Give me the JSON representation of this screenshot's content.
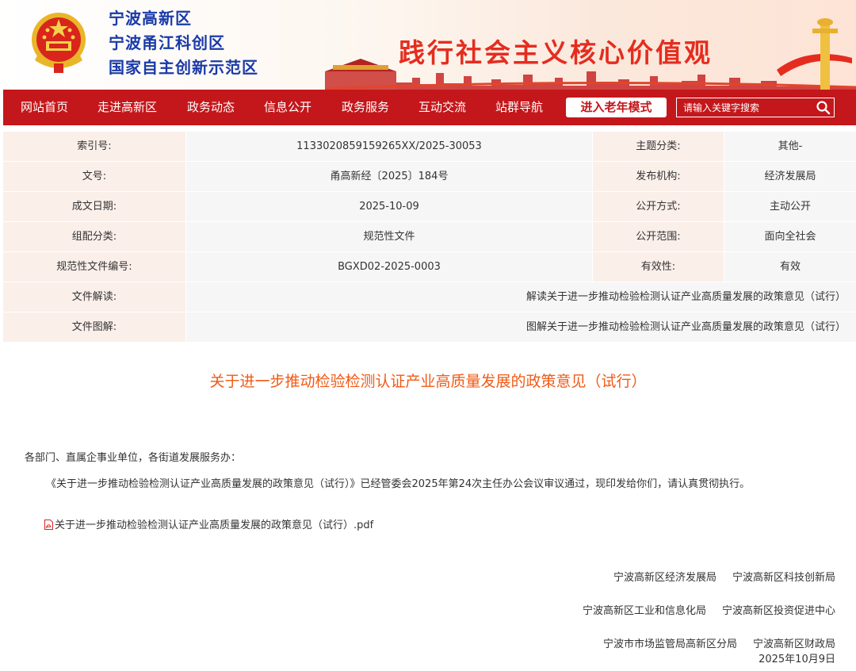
{
  "header": {
    "site_names": [
      "宁波高新区",
      "宁波甬江科创区",
      "国家自主创新示范区"
    ],
    "slogan": "践行社会主义核心价值观",
    "emblem_icon": "national-emblem-icon"
  },
  "nav": {
    "items": [
      "网站首页",
      "走进高新区",
      "政务动态",
      "信息公开",
      "政务服务",
      "互动交流",
      "站群导航"
    ],
    "elder_mode": "进入老年模式",
    "search_placeholder": "请输入关键字搜索",
    "search_icon": "search-icon"
  },
  "meta": {
    "index_label": "索引号:",
    "index_value": "113302085915926 5XX/2025-30053",
    "topic_label": "主题分类:",
    "topic_value": "其他-",
    "doc_no_label": "文号:",
    "doc_no_value": "甬高新经〔2025〕184号",
    "issuer_label": "发布机构:",
    "issuer_value": "经济发展局",
    "date_label": "成文日期:",
    "date_value": "2025-10-09",
    "open_mode_label": "公开方式:",
    "open_mode_value": "主动公开",
    "category_label": "组配分类:",
    "category_value": "规范性文件",
    "scope_label": "公开范围:",
    "scope_value": "面向全社会",
    "norm_no_label": "规范性文件编号:",
    "norm_no_value": "BGXD02-2025-0003",
    "validity_label": "有效性:",
    "validity_value": "有效",
    "interpret_label": "文件解读:",
    "interpret_value": "解读关于进一步推动检验检测认证产业高质量发展的政策意见（试行）",
    "graphic_label": "文件图解:",
    "graphic_value": "图解关于进一步推动检验检测认证产业高质量发展的政策意见（试行）"
  },
  "article": {
    "title": "关于进一步推动检验检测认证产业高质量发展的政策意见（试行）",
    "salutation": "各部门、直属企事业单位，各街道发展服务办：",
    "body": "《关于进一步推动检验检测认证产业高质量发展的政策意见（试行）》已经管委会2025年第24次主任办公会议审议通过，现印发给你们，请认真贯彻执行。",
    "attachment": "关于进一步推动检验检测认证产业高质量发展的政策意见（试行）.pdf",
    "attachment_icon": "pdf-icon",
    "signers": [
      [
        "宁波高新区经济发展局",
        "宁波高新区科技创新局"
      ],
      [
        "宁波高新区工业和信息化局",
        "宁波高新区投资促进中心"
      ],
      [
        "宁波市市场监管局高新区分局",
        "宁波高新区财政局"
      ]
    ],
    "date": "2025年10月9日"
  },
  "colors": {
    "brand_red": "#c4171b",
    "title_orange": "#f05a16",
    "name_blue": "#1a3aa8"
  }
}
